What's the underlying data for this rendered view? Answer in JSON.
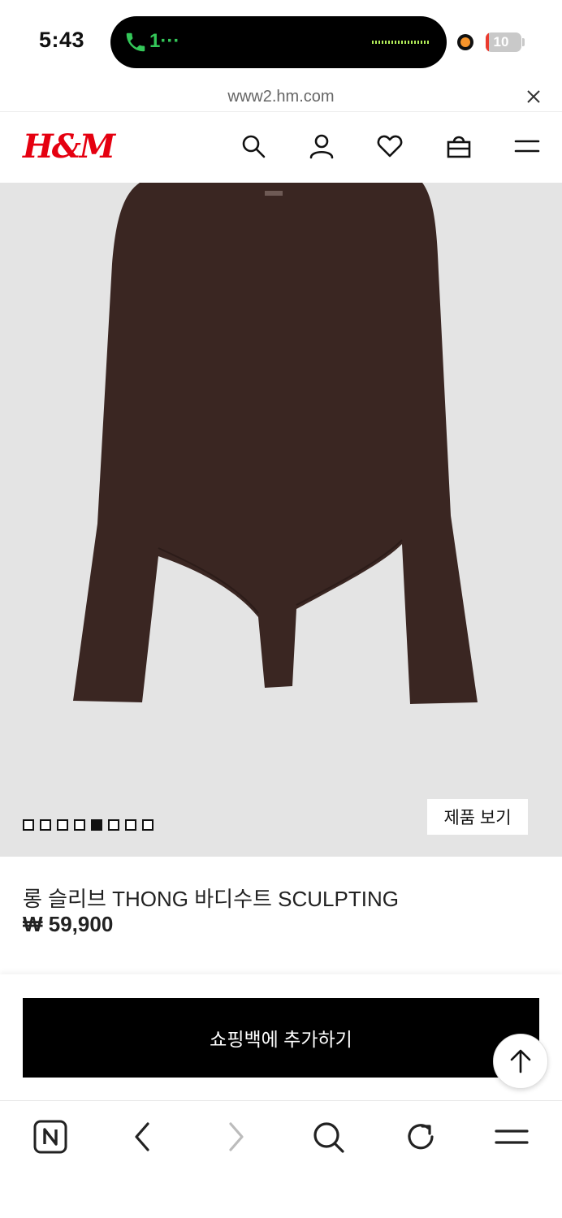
{
  "status_bar": {
    "time": "5:43",
    "call_label": "1···",
    "battery_percent": "10",
    "battery_level": 0.1,
    "accent_green": "#34c759",
    "recording_dot_color": "#f7942b"
  },
  "browser": {
    "url": "www2.hm.com"
  },
  "header": {
    "logo_text": "H&M",
    "brand_color": "#e50010",
    "icons": [
      "search-icon",
      "account-icon",
      "favorites-icon",
      "shopping-bag-icon",
      "menu-icon"
    ]
  },
  "gallery": {
    "image_count": 8,
    "active_index": 4,
    "view_product_label": "제품 보기",
    "garment_color": "#3a2622",
    "background_color": "#e4e4e4"
  },
  "product": {
    "name": "롱 슬리브 THONG 바디수트 SCULPTING",
    "price": "₩ 59,900"
  },
  "actions": {
    "add_to_bag_label": "쇼핑백에 추가하기"
  },
  "browser_toolbar": {
    "icons": [
      "naver-icon",
      "back-icon",
      "forward-icon",
      "search-icon",
      "reload-icon",
      "menu-icon"
    ]
  }
}
